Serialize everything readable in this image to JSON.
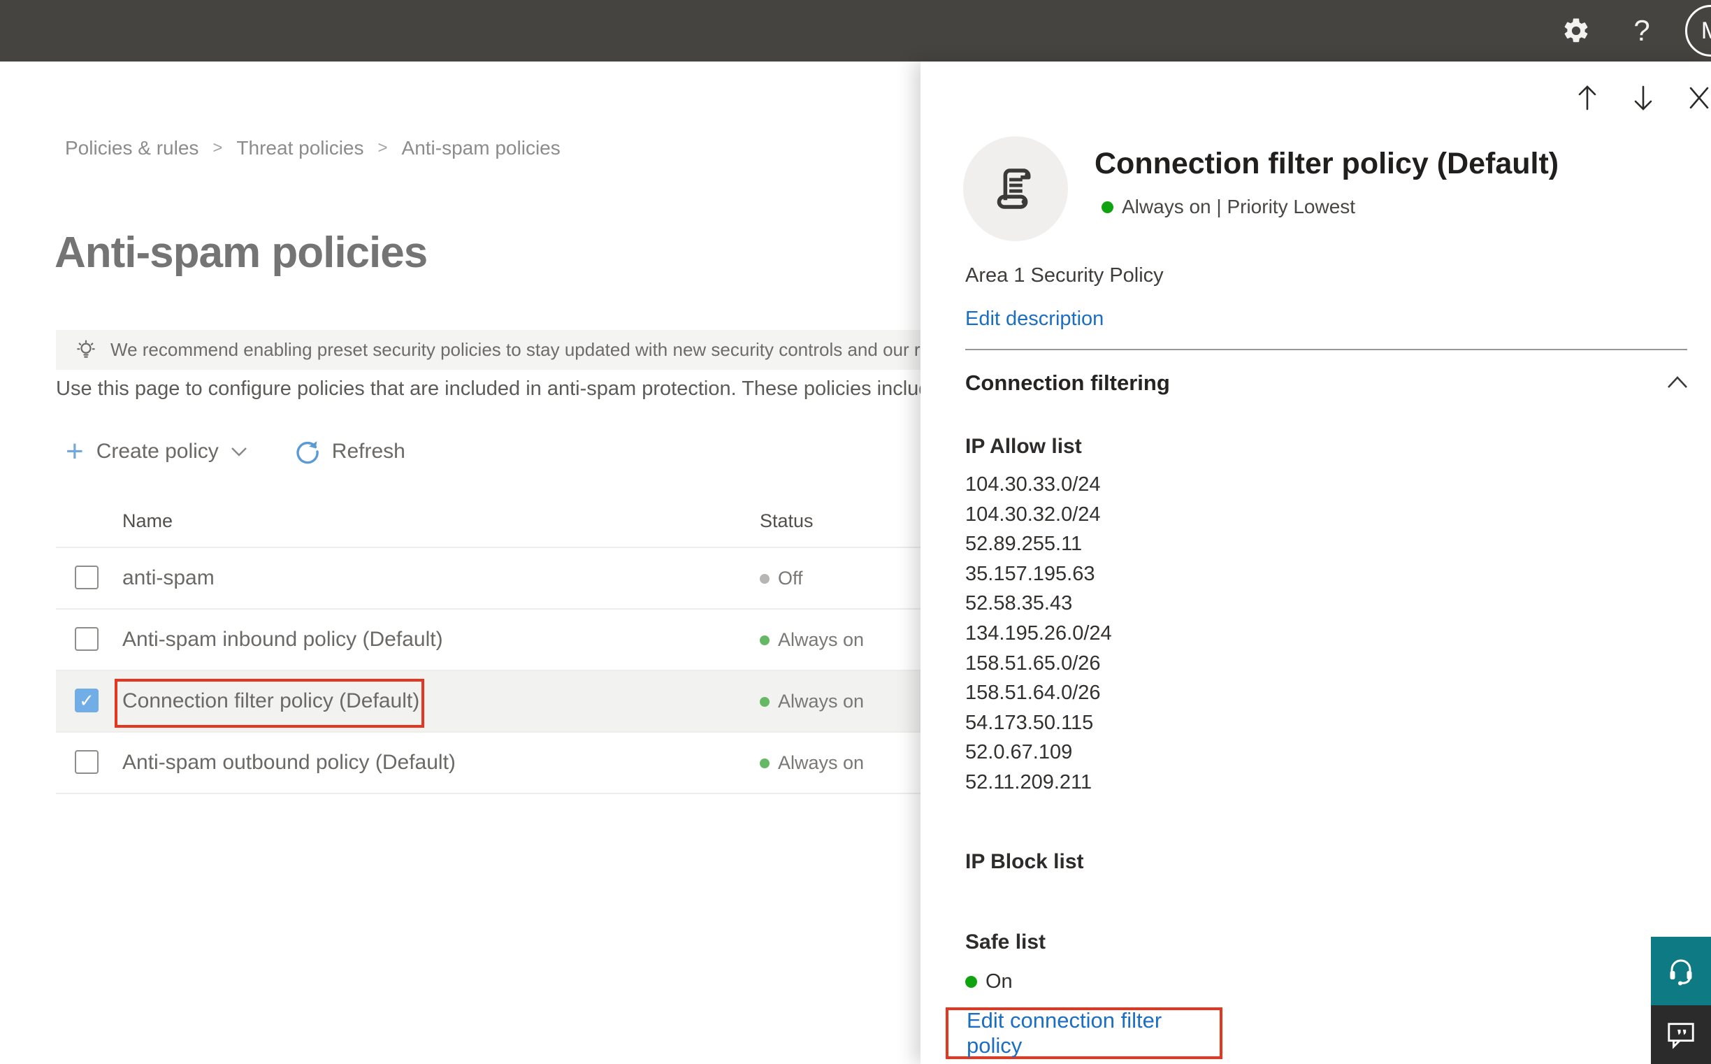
{
  "colors": {
    "topbar_bg": "#454441",
    "accent_blue": "#71a9dd",
    "link_blue": "#1b6ec2",
    "selection_red": "#e5371f",
    "status_green": "#65b965",
    "status_green_bright": "#0fa30f",
    "status_gray": "#b8b6b4",
    "help_widget_teal": "#0e7a84"
  },
  "icons": {
    "topbar": [
      "gear-icon",
      "help-icon"
    ],
    "panel_nav": [
      "arrow-up-icon",
      "arrow-down-icon",
      "close-icon"
    ],
    "policy": "scroll-icon",
    "banner": "lightbulb-icon",
    "widgets": [
      "headset-icon",
      "feedback-icon"
    ]
  },
  "topbar": {
    "help_glyph": "?",
    "avatar_initial": "M"
  },
  "breadcrumb": {
    "items": [
      "Policies & rules",
      "Threat policies",
      "Anti-spam policies"
    ],
    "separator": ">"
  },
  "page": {
    "title": "Anti-spam policies",
    "banner_text": "We recommend enabling preset security policies to stay updated with new security controls and our recomme",
    "description": "Use this page to configure policies that are included in anti-spam protection. These policies include",
    "toolbar": {
      "create_policy_label": "Create policy",
      "refresh_label": "Refresh",
      "plus_glyph": "+"
    }
  },
  "table": {
    "columns": {
      "name": "Name",
      "status": "Status"
    },
    "rows": [
      {
        "name": "anti-spam",
        "status": "Off",
        "status_color": "gray",
        "checked": false,
        "selected": false,
        "outlined": false
      },
      {
        "name": "Anti-spam inbound policy (Default)",
        "status": "Always on",
        "status_color": "green",
        "checked": false,
        "selected": false,
        "outlined": false
      },
      {
        "name": "Connection filter policy (Default)",
        "status": "Always on",
        "status_color": "green",
        "checked": true,
        "selected": true,
        "outlined": true
      },
      {
        "name": "Anti-spam outbound policy (Default)",
        "status": "Always on",
        "status_color": "green",
        "checked": false,
        "selected": false,
        "outlined": false
      }
    ]
  },
  "panel": {
    "title": "Connection filter policy (Default)",
    "status_line": "Always on | Priority Lowest",
    "description": "Area 1 Security Policy",
    "edit_description_label": "Edit description",
    "section_title": "Connection filtering",
    "ip_allow": {
      "title": "IP Allow list",
      "items": [
        "104.30.33.0/24",
        "104.30.32.0/24",
        "52.89.255.11",
        "35.157.195.63",
        "52.58.35.43",
        "134.195.26.0/24",
        "158.51.65.0/26",
        "158.51.64.0/26",
        "54.173.50.115",
        "52.0.67.109",
        "52.11.209.211"
      ]
    },
    "ip_block": {
      "title": "IP Block list"
    },
    "safe_list": {
      "title": "Safe list",
      "status": "On"
    },
    "edit_link_label": "Edit connection filter policy"
  }
}
